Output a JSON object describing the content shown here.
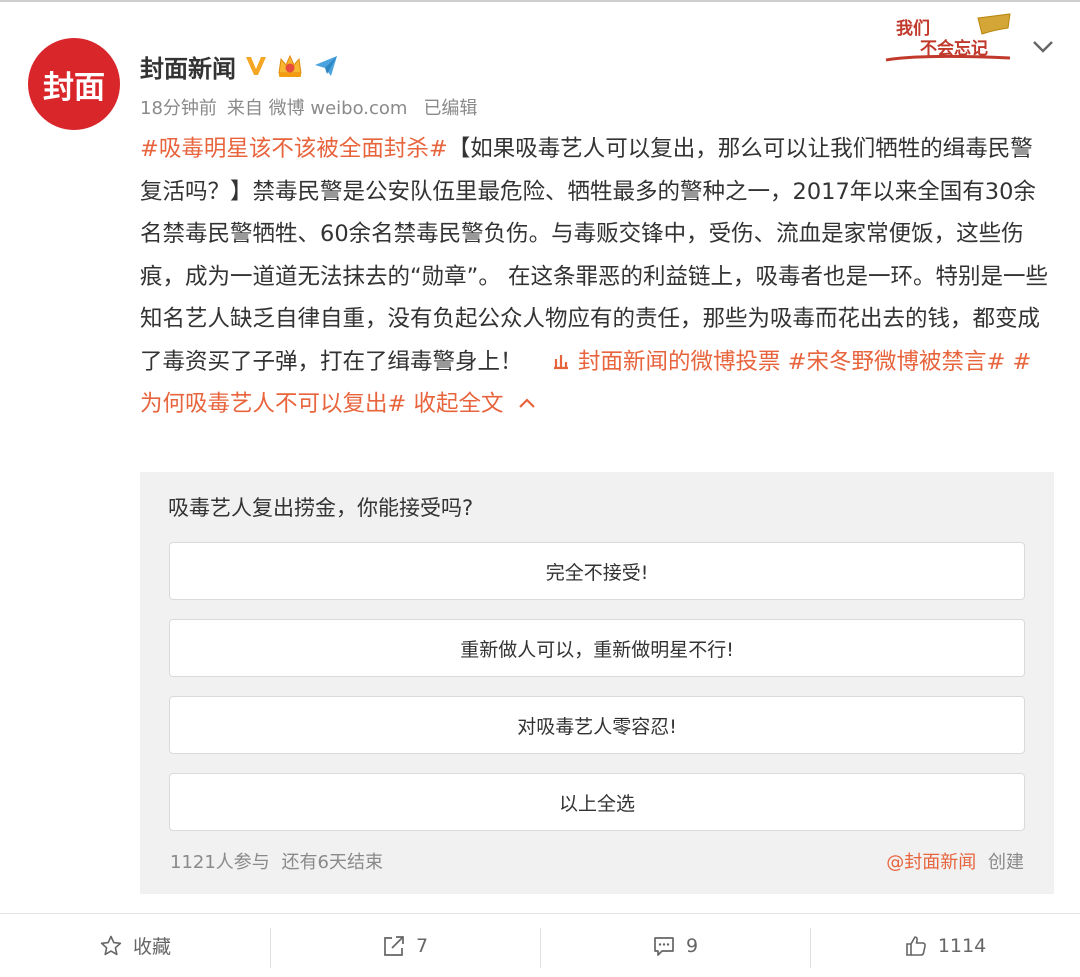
{
  "user": {
    "name": "封面新闻",
    "avatar_text": "封面",
    "time": "18分钟前",
    "source": "来自 微博 weibo.com",
    "edited": "已编辑",
    "stamp_line1": "我们",
    "stamp_line2": "不会忘记"
  },
  "post": {
    "hashtag_main": "#吸毒明星该不该被全面封杀#",
    "body": "【如果吸毒艺人可以复出，那么可以让我们牺牲的缉毒民警复活吗？】禁毒民警是公安队伍里最危险、牺牲最多的警种之一，2017年以来全国有30余名禁毒民警牺牲、60余名禁毒民警负伤。与毒贩交锋中，受伤、流血是家常便饭，这些伤痕，成为一道道无法抹去的“勋章”。 在这条罪恶的利益链上，吸毒者也是一环。特别是一些知名艺人缺乏自律自重，没有负起公众人物应有的责任，那些为吸毒而花出去的钱，都变成了毒资买了子弹，打在了缉毒警身上！",
    "vote_link": "封面新闻的微博投票",
    "hashtag_2": "#宋冬野微博被禁言#",
    "hashtag_3": "#为何吸毒艺人不可以复出#",
    "collapse": "收起全文"
  },
  "poll": {
    "question": "吸毒艺人复出捞金，你能接受吗?",
    "options": [
      "完全不接受!",
      "重新做人可以，重新做明星不行!",
      "对吸毒艺人零容忍!",
      "以上全选"
    ],
    "participants": "1121人参与",
    "remaining": "还有6天结束",
    "creator": "@封面新闻",
    "created": "创建"
  },
  "actions": {
    "favorite_label": "收藏",
    "repost_count": "7",
    "comment_count": "9",
    "like_count": "1114"
  },
  "colors": {
    "accent": "#e8643d",
    "avatar": "#d8262b",
    "verified": "#f5a623"
  }
}
